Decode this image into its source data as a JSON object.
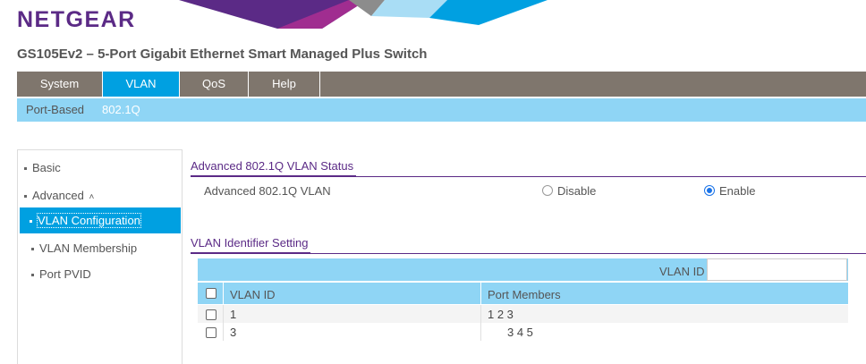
{
  "header": {
    "logo": "NETGEAR",
    "product_title": "GS105Ev2 – 5-Port Gigabit Ethernet Smart Managed Plus Switch"
  },
  "menu": [
    {
      "label": "System",
      "active": false
    },
    {
      "label": "VLAN",
      "active": true
    },
    {
      "label": "QoS",
      "active": false
    },
    {
      "label": "Help",
      "active": false
    }
  ],
  "submenu": [
    {
      "label": "Port-Based",
      "active": false
    },
    {
      "label": "802.1Q",
      "active": true
    }
  ],
  "sidebar": {
    "basic": "Basic",
    "advanced": "Advanced",
    "advanced_caret": "˄",
    "items": [
      "VLAN Configuration",
      "VLAN Membership",
      "Port PVID"
    ]
  },
  "status_section": {
    "title": "Advanced 802.1Q VLAN Status",
    "row_label": "Advanced 802.1Q VLAN",
    "disable_label": "Disable",
    "enable_label": "Enable",
    "selected": "Enable"
  },
  "vlan_section": {
    "title": "VLAN Identifier Setting",
    "search_label": "VLAN ID",
    "search_value": "",
    "columns": [
      "VLAN ID",
      "Port Members"
    ],
    "rows": [
      {
        "vlan_id": "1",
        "members": "1 2 3"
      },
      {
        "vlan_id": "3",
        "members": "3 4 5"
      }
    ]
  },
  "colors": {
    "brand_purple": "#5b2a86",
    "menu_bg": "#7f766d",
    "accent_blue": "#00a0e1",
    "light_blue": "#8fd5f5"
  }
}
